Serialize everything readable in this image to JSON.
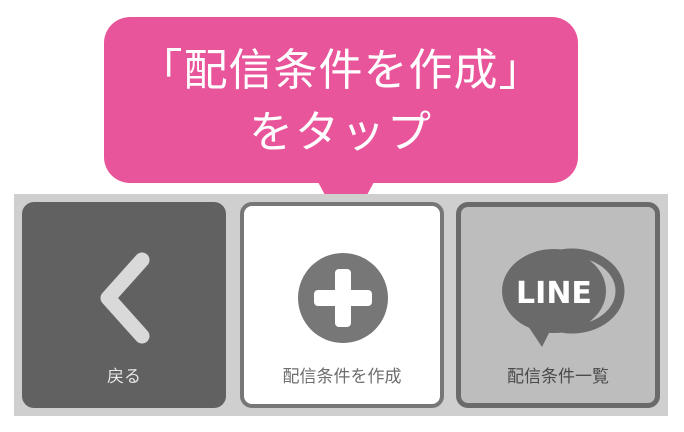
{
  "callout": {
    "line1": "「配信条件を作成」",
    "line2": "をタップ",
    "color": "#e9559b"
  },
  "toolbar": {
    "back": {
      "label": "戻る",
      "icon": "chevron-left-icon"
    },
    "create": {
      "label": "配信条件を作成",
      "icon": "plus-circle-icon"
    },
    "list": {
      "label": "配信条件一覧",
      "icon": "line-logo-icon",
      "icon_text": "LINE"
    }
  }
}
